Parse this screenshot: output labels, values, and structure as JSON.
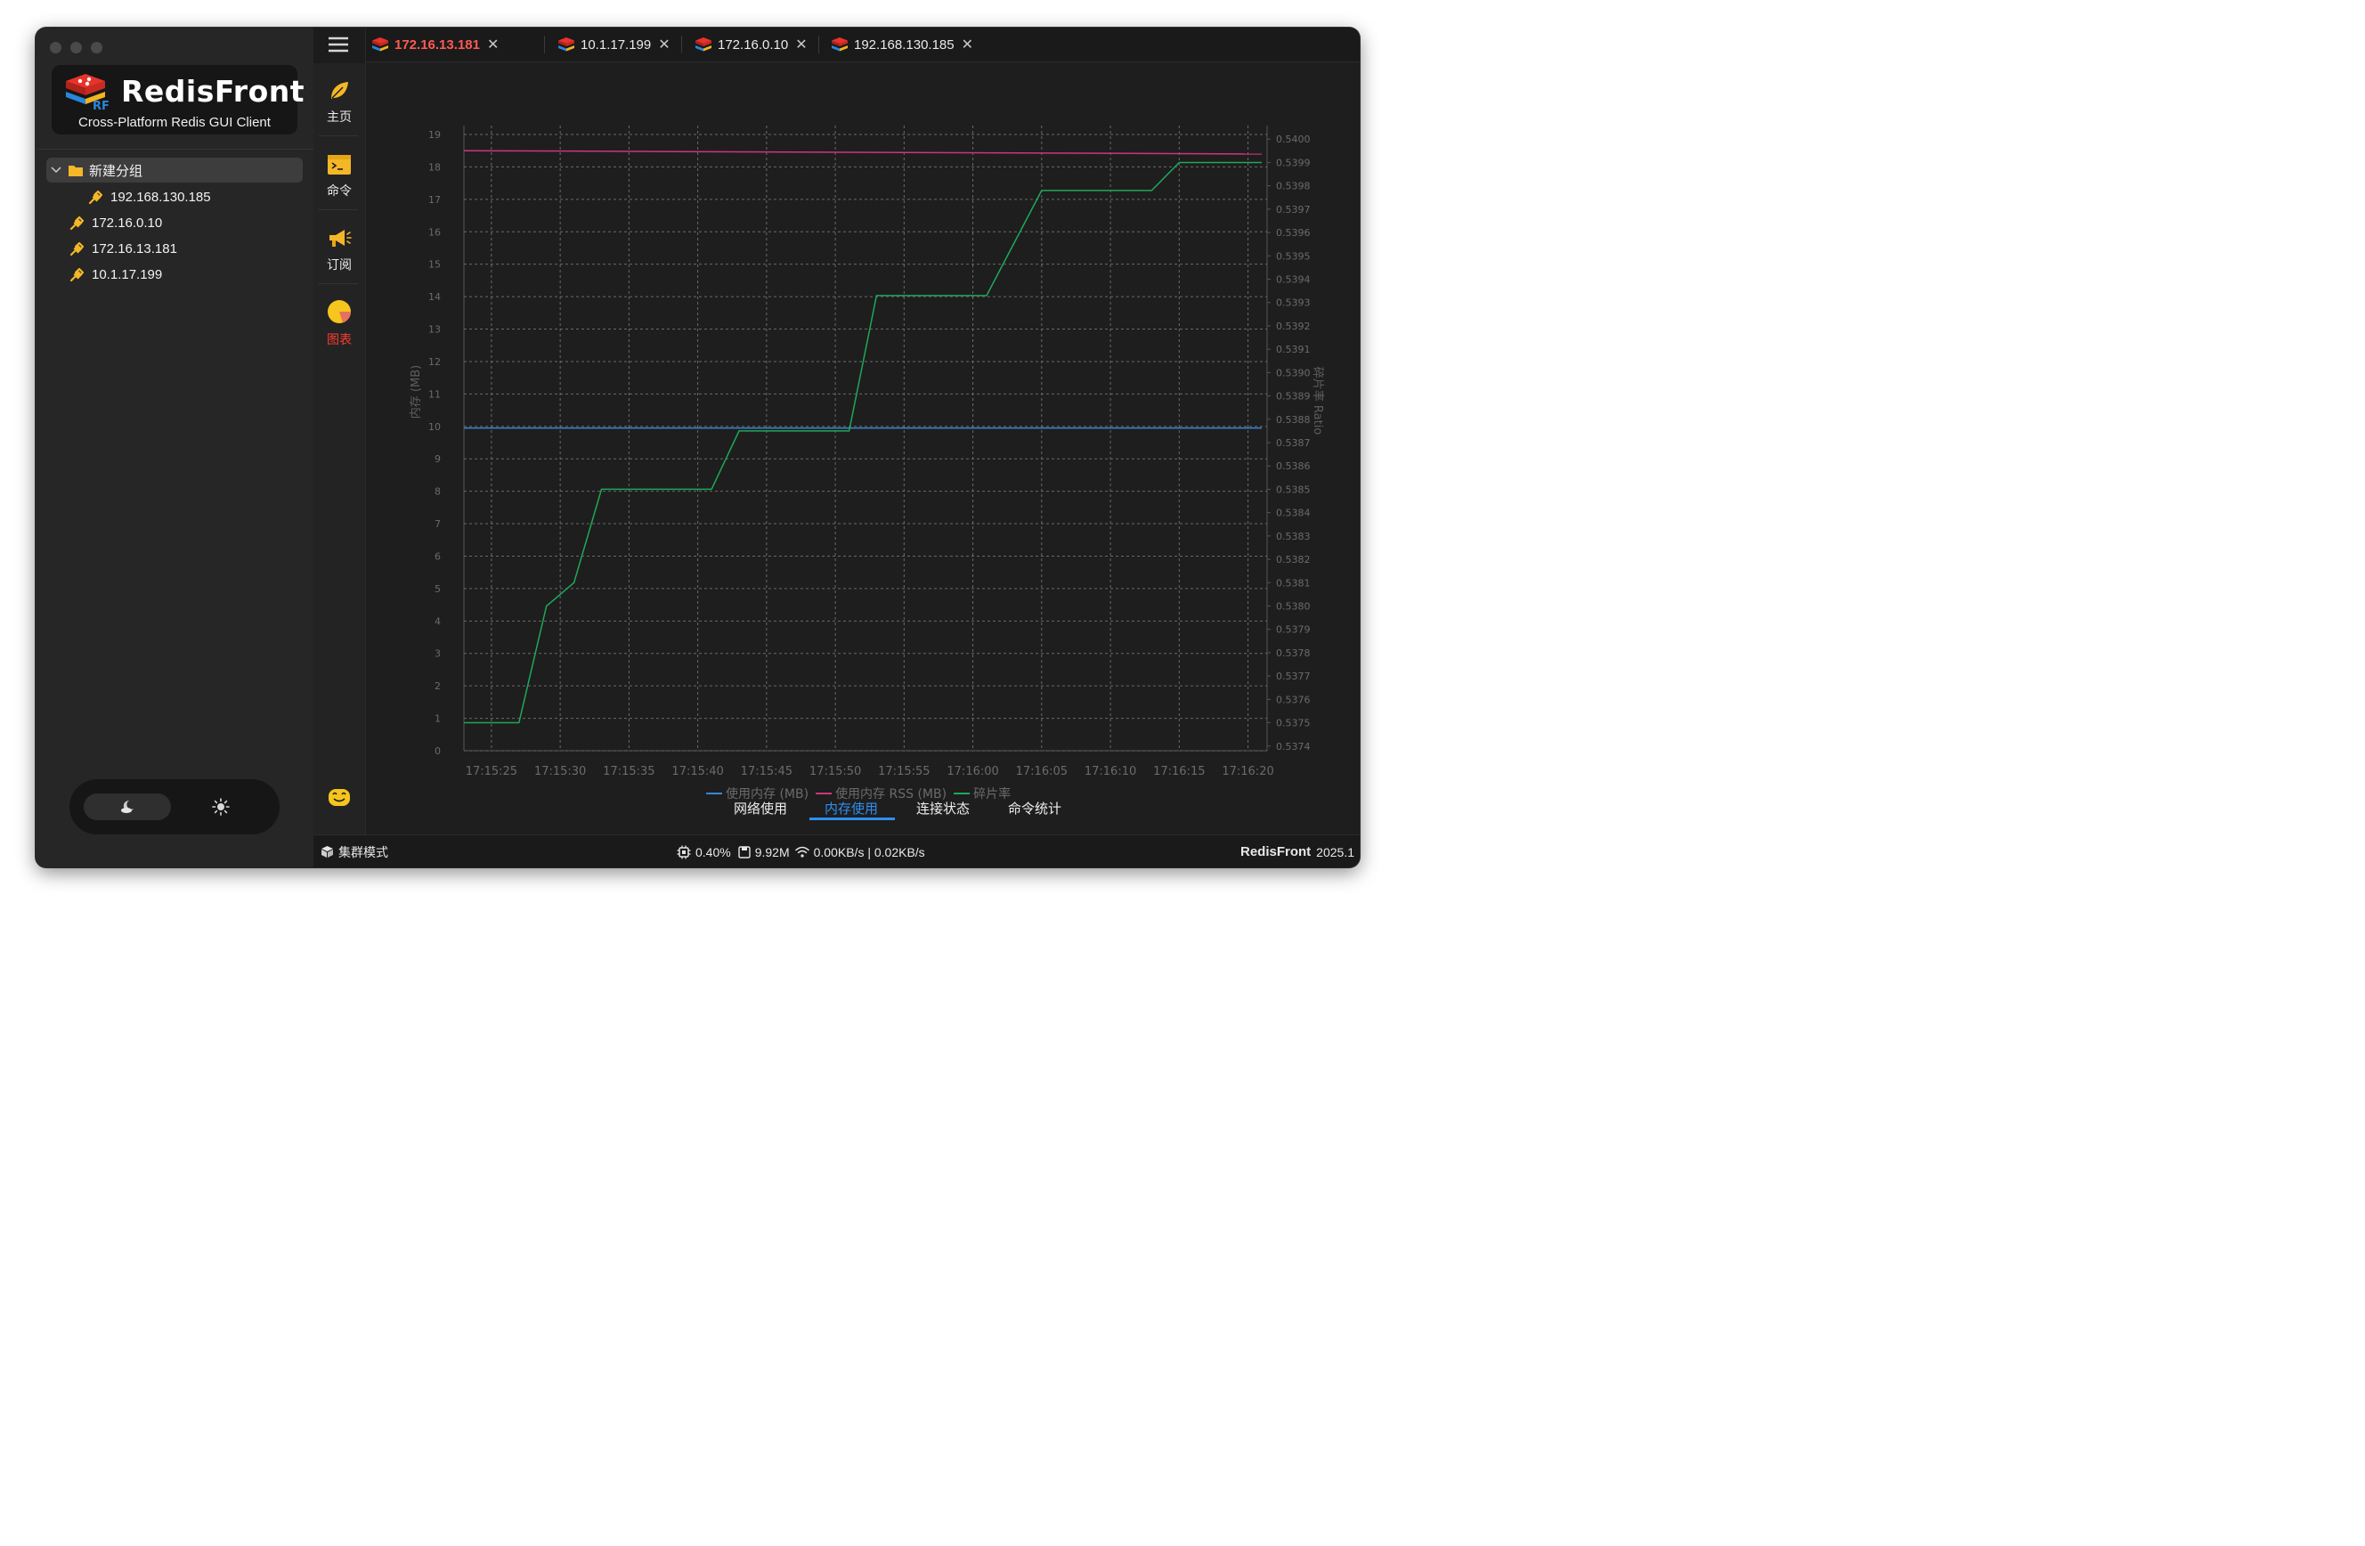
{
  "app": {
    "brand_title": "RedisFront",
    "brand_subtitle": "Cross-Platform Redis GUI Client"
  },
  "sidebar": {
    "group": {
      "label": "新建分组",
      "child": "192.168.130.185"
    },
    "connections": [
      "172.16.0.10",
      "172.16.13.181",
      "10.1.17.199"
    ]
  },
  "rail": {
    "items": [
      {
        "label": "主页",
        "icon": "leaf-icon"
      },
      {
        "label": "命令",
        "icon": "terminal-icon"
      },
      {
        "label": "订阅",
        "icon": "megaphone-icon"
      },
      {
        "label": "图表",
        "icon": "pie-chart-icon"
      }
    ],
    "active_index": 3
  },
  "tabs": [
    {
      "label": "172.16.13.181",
      "active": true
    },
    {
      "label": "10.1.17.199",
      "active": false
    },
    {
      "label": "172.16.0.10",
      "active": false
    },
    {
      "label": "192.168.130.185",
      "active": false
    }
  ],
  "subtabs": {
    "items": [
      "网络使用",
      "内存使用",
      "连接状态",
      "命令统计"
    ],
    "active_index": 1
  },
  "status": {
    "mode": "集群模式",
    "cpu": "0.40%",
    "memory": "9.92M",
    "network": "0.00KB/s | 0.02KB/s",
    "brand": "RedisFront",
    "version": "2025.1"
  },
  "colors": {
    "active_tab": "#ff5a52",
    "active_rail": "#ff3b30",
    "subtab_active": "#2f8ff0",
    "series_used": "#3a86d4",
    "series_rss": "#d0357a",
    "series_frag": "#1fa85a"
  },
  "chart_data": {
    "type": "line",
    "x": [
      "17:15:25",
      "17:15:30",
      "17:15:35",
      "17:15:40",
      "17:15:45",
      "17:15:50",
      "17:15:55",
      "17:16:00",
      "17:16:05",
      "17:16:10",
      "17:16:15",
      "17:16:20"
    ],
    "ylabel": "内存 (MB)",
    "y2label": "碎片率 Ratio",
    "ylim": [
      0,
      19
    ],
    "y2lim": [
      0.5374,
      0.54
    ],
    "yticks": [
      "0",
      "1",
      "2",
      "3",
      "4",
      "5",
      "6",
      "7",
      "8",
      "9",
      "10",
      "11",
      "12",
      "13",
      "14",
      "15",
      "16",
      "17",
      "18",
      "19"
    ],
    "y2ticks": [
      "0.5374",
      "0.5375",
      "0.5376",
      "0.5377",
      "0.5378",
      "0.5379",
      "0.5380",
      "0.5381",
      "0.5382",
      "0.5383",
      "0.5384",
      "0.5385",
      "0.5386",
      "0.5387",
      "0.5388",
      "0.5389",
      "0.5390",
      "0.5391",
      "0.5392",
      "0.5393",
      "0.5394",
      "0.5395",
      "0.5396",
      "0.5397",
      "0.5398",
      "0.5399",
      "0.5400"
    ],
    "grid": true,
    "legend": "bottom",
    "series": [
      {
        "name": "使用内存 (MB)",
        "axis": "left",
        "color": "#3a86d4",
        "points": [
          [
            "17:15:23",
            9.95
          ],
          [
            "17:16:21",
            9.95
          ]
        ]
      },
      {
        "name": "使用内存 RSS (MB)",
        "axis": "left",
        "color": "#d0357a",
        "points": [
          [
            "17:15:23",
            18.5
          ],
          [
            "17:16:21",
            18.4
          ]
        ]
      },
      {
        "name": "碎片率",
        "axis": "right",
        "color": "#1fa85a",
        "points": [
          [
            "17:15:23",
            0.5375
          ],
          [
            "17:15:25",
            0.5375
          ],
          [
            "17:15:27",
            0.5375
          ],
          [
            "17:15:29",
            0.538
          ],
          [
            "17:15:31",
            0.5381
          ],
          [
            "17:15:33",
            0.5385
          ],
          [
            "17:15:41",
            0.5385
          ],
          [
            "17:15:43",
            0.53875
          ],
          [
            "17:15:51",
            0.53875
          ],
          [
            "17:15:53",
            0.53933
          ],
          [
            "17:16:01",
            0.53933
          ],
          [
            "17:16:05",
            0.53978
          ],
          [
            "17:16:13",
            0.53978
          ],
          [
            "17:16:15",
            0.5399
          ],
          [
            "17:16:21",
            0.5399
          ]
        ]
      }
    ]
  }
}
